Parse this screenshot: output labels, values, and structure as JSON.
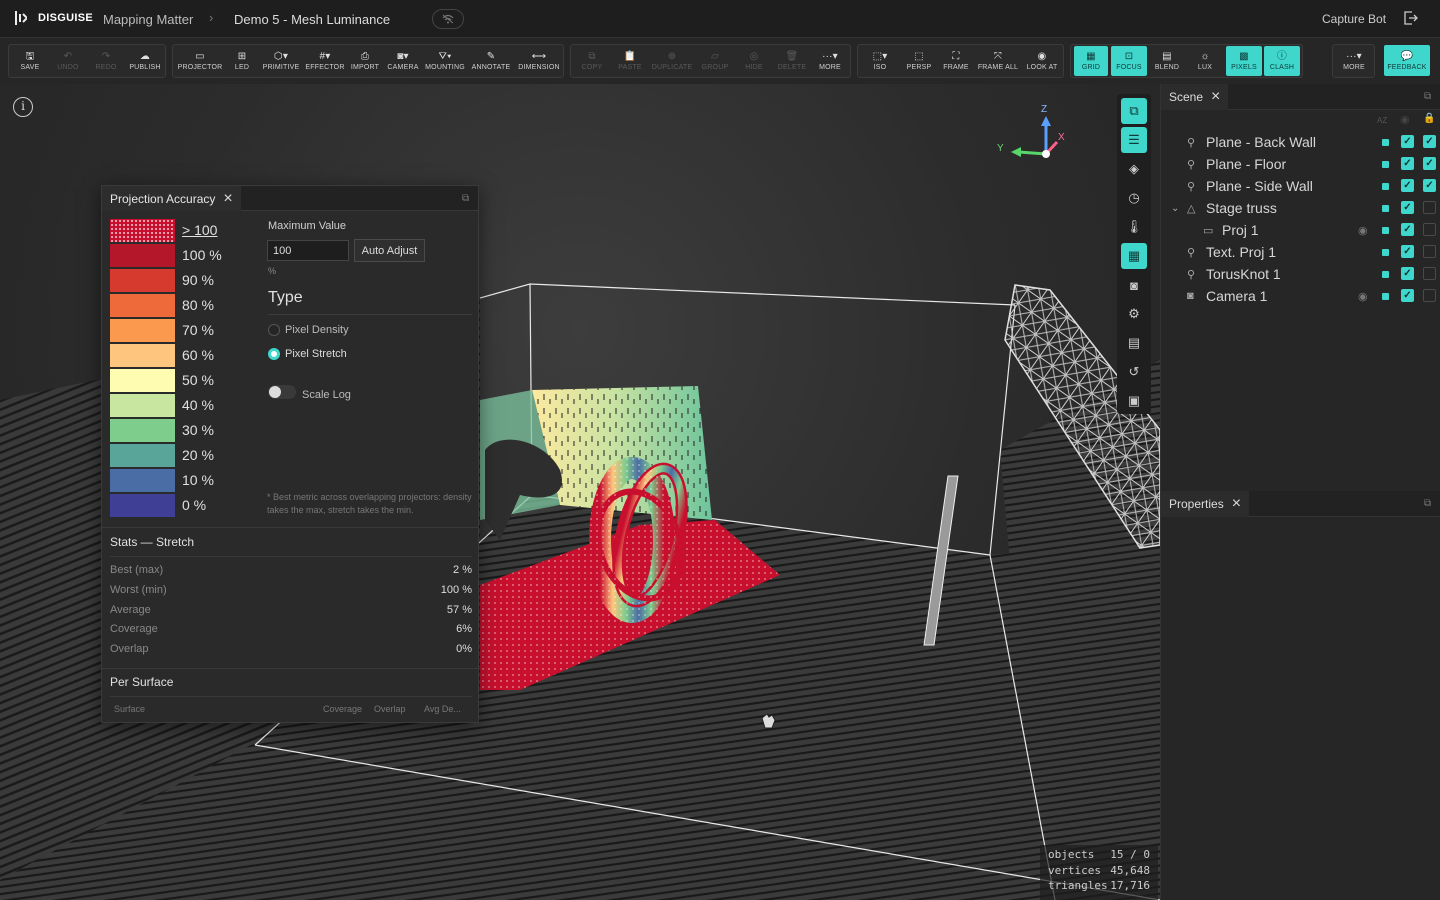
{
  "brand": "DISGUISE",
  "breadcrumb": [
    "Mapping Matter",
    "Demo 5 - Mesh Luminance"
  ],
  "user": "Capture Bot",
  "toolbar": {
    "file": [
      "SAVE",
      "UNDO",
      "REDO",
      "PUBLISH"
    ],
    "create": [
      "PROJECTOR",
      "LED",
      "PRIMITIVE",
      "EFFECTOR",
      "IMPORT",
      "CAMERA",
      "MOUNTING",
      "ANNOTATE",
      "DIMENSION"
    ],
    "edit": [
      "COPY",
      "PASTE",
      "DUPLICATE",
      "GROUP",
      "HIDE",
      "DELETE",
      "MORE"
    ],
    "view": [
      "ISO",
      "PERSP",
      "FRAME",
      "FRAME ALL",
      "LOOK AT"
    ],
    "display": [
      "GRID",
      "FOCUS",
      "BLEND",
      "LUX",
      "PIXELS",
      "CLASH"
    ],
    "more": "MORE",
    "feedback": "FEEDBACK"
  },
  "projection_panel": {
    "title": "Projection Accuracy",
    "legend": [
      {
        "label": "> 100",
        "color": "#c8102e"
      },
      {
        "label": "100 %",
        "color": "#b5172a"
      },
      {
        "label": "90 %",
        "color": "#d63a2e"
      },
      {
        "label": "80 %",
        "color": "#ee6a3a"
      },
      {
        "label": "70 %",
        "color": "#fb9a4e"
      },
      {
        "label": "60 %",
        "color": "#fdc57d"
      },
      {
        "label": "50 %",
        "color": "#fefcb0"
      },
      {
        "label": "40 %",
        "color": "#c9e6a0"
      },
      {
        "label": "30 %",
        "color": "#7fcd8c"
      },
      {
        "label": "20 %",
        "color": "#5aa59a"
      },
      {
        "label": "10 %",
        "color": "#4b6da5"
      },
      {
        "label": "0 %",
        "color": "#3f3f96"
      }
    ],
    "max_value_label": "Maximum Value",
    "max_value": "100",
    "auto_adjust": "Auto Adjust",
    "unit": "%",
    "type_label": "Type",
    "type_options": [
      "Pixel Density",
      "Pixel Stretch"
    ],
    "type_selected": "Pixel Stretch",
    "scale_log": "Scale Log",
    "note": "* Best metric across overlapping projectors: density takes the max, stretch takes the min.",
    "stats_title": "Stats — Stretch",
    "stats": [
      {
        "label": "Best (max)",
        "value": "2 %"
      },
      {
        "label": "Worst (min)",
        "value": "100 %"
      },
      {
        "label": "Average",
        "value": "57 %"
      },
      {
        "label": "Coverage",
        "value": "6%"
      },
      {
        "label": "Overlap",
        "value": "0%"
      }
    ],
    "per_surface_title": "Per Surface",
    "per_surface_columns": [
      "Surface",
      "Coverage",
      "Overlap",
      "Avg De..."
    ]
  },
  "scene_panel": {
    "title": "Scene",
    "sort_label": "AZ",
    "items": [
      {
        "label": "Plane - Back Wall",
        "icon": "mesh-icon",
        "checked": true,
        "locked": true
      },
      {
        "label": "Plane - Floor",
        "icon": "mesh-icon",
        "checked": true,
        "locked": true
      },
      {
        "label": "Plane - Side Wall",
        "icon": "mesh-icon",
        "checked": true,
        "locked": true
      },
      {
        "label": "Stage truss",
        "icon": "truss-icon",
        "checked": true,
        "locked": false
      },
      {
        "label": "Proj 1",
        "icon": "projector-icon",
        "checked": true,
        "locked": false
      },
      {
        "label": "Text. Proj 1",
        "icon": "mesh-icon",
        "checked": true,
        "locked": false
      },
      {
        "label": "TorusKnot 1",
        "icon": "mesh-icon",
        "checked": true,
        "locked": false
      },
      {
        "label": "Camera 1",
        "icon": "camera-icon",
        "checked": true,
        "locked": false
      }
    ]
  },
  "properties_panel": {
    "title": "Properties"
  },
  "axes": {
    "z": "Z",
    "x": "X",
    "y": "Y"
  },
  "stats_overlay": [
    {
      "label": "objects",
      "value": "15 / 0"
    },
    {
      "label": "vertices",
      "value": "45,648"
    },
    {
      "label": "triangles",
      "value": "17,716"
    }
  ],
  "colors": {
    "accent": "#3fd6cc"
  }
}
